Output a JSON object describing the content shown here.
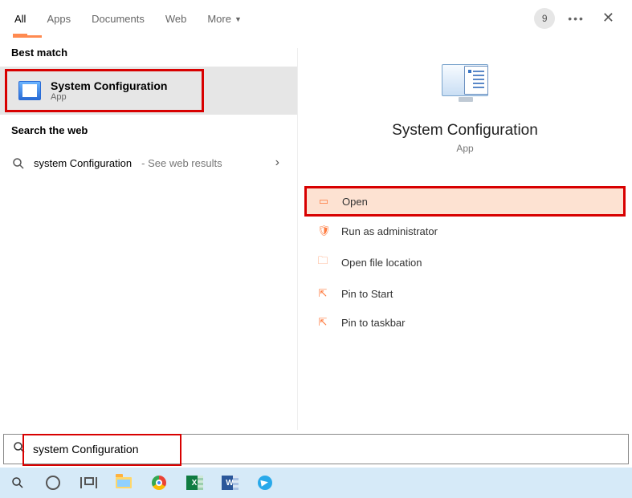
{
  "header": {
    "tabs": {
      "all": "All",
      "apps": "Apps",
      "documents": "Documents",
      "web": "Web",
      "more": "More"
    },
    "badge": "9"
  },
  "left": {
    "best_match_label": "Best match",
    "result": {
      "title": "System Configuration",
      "subtitle": "App"
    },
    "search_web_label": "Search the web",
    "web": {
      "query": "system Configuration",
      "hint": "See web results"
    }
  },
  "right": {
    "title": "System Configuration",
    "subtitle": "App",
    "actions": {
      "open": "Open",
      "run_admin": "Run as administrator",
      "open_loc": "Open file location",
      "pin_start": "Pin to Start",
      "pin_taskbar": "Pin to taskbar"
    }
  },
  "search": {
    "value": "system Configuration"
  },
  "colors": {
    "accent": "#ff8a50",
    "highlight_border": "#d80000",
    "highlight_bg": "#fde2d2"
  }
}
